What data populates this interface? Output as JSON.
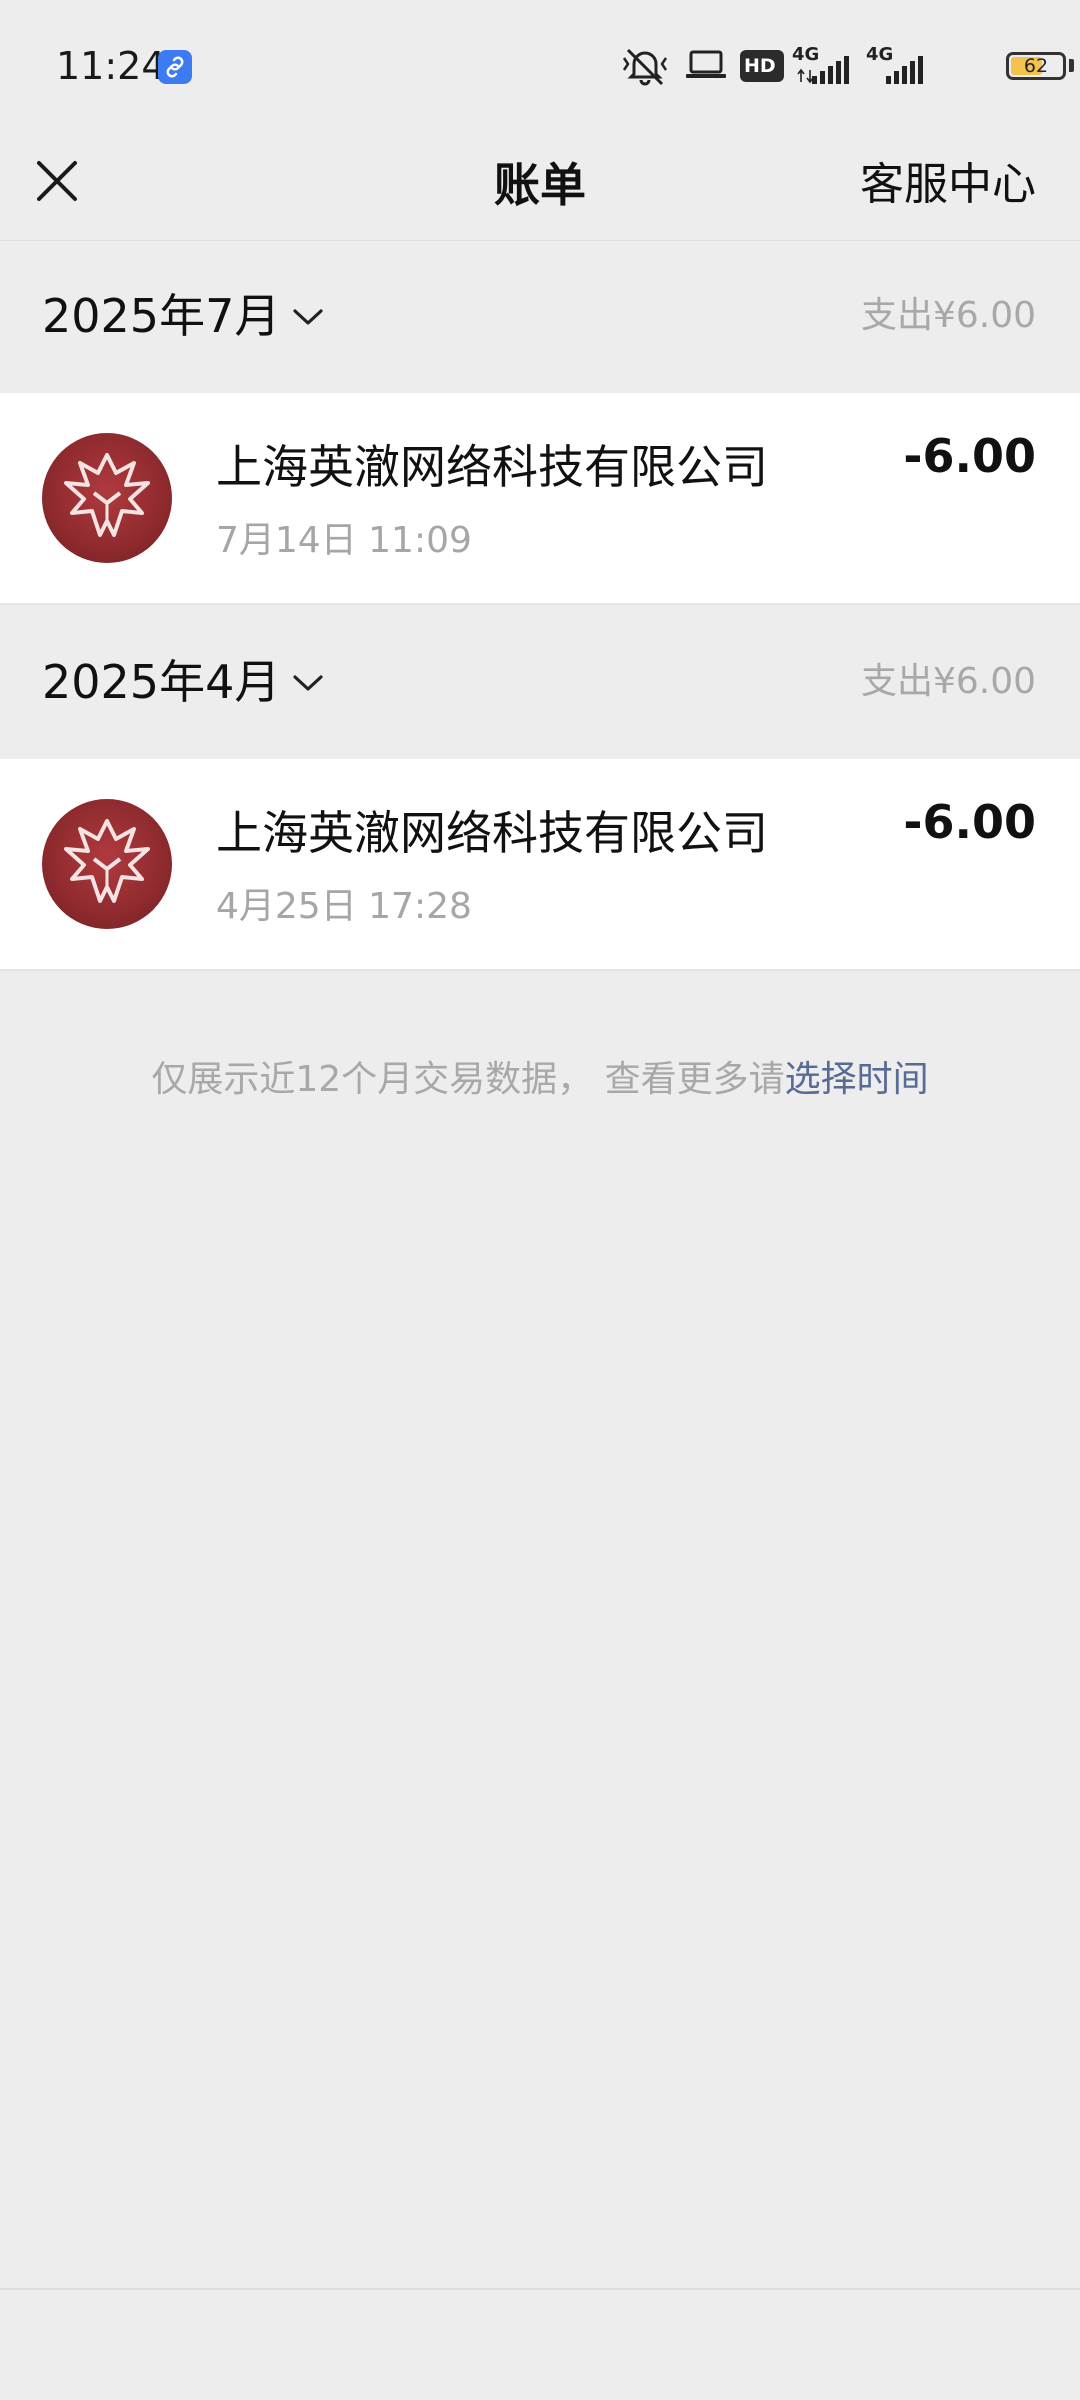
{
  "status_bar": {
    "time": "11:24",
    "hd_label": "HD",
    "network_1": "4G",
    "network_2": "4G",
    "battery": "62",
    "battery_level": 0.62,
    "icons": [
      "link-icon",
      "mute-bell-icon",
      "laptop-icon",
      "signal-icon",
      "battery-icon"
    ]
  },
  "nav": {
    "title": "账单",
    "service_center": "客服中心",
    "close_icon": "close-icon"
  },
  "months": [
    {
      "label": "2025年7月",
      "summary": "支出¥6.00",
      "transactions": [
        {
          "merchant": "上海英澈网络科技有限公司",
          "time": "7月14日 11:09",
          "amount": "-6.00"
        }
      ]
    },
    {
      "label": "2025年4月",
      "summary": "支出¥6.00",
      "transactions": [
        {
          "merchant": "上海英澈网络科技有限公司",
          "time": "4月25日 17:28",
          "amount": "-6.00"
        }
      ]
    }
  ],
  "footer": {
    "note": "仅展示近12个月交易数据， 查看更多请",
    "link": "选择时间"
  },
  "colors": {
    "background": "#EDEDED",
    "card": "#FFFFFF",
    "link": "#576B95",
    "muted_text": "#A8A8A8",
    "avatar": "#9B3035"
  }
}
